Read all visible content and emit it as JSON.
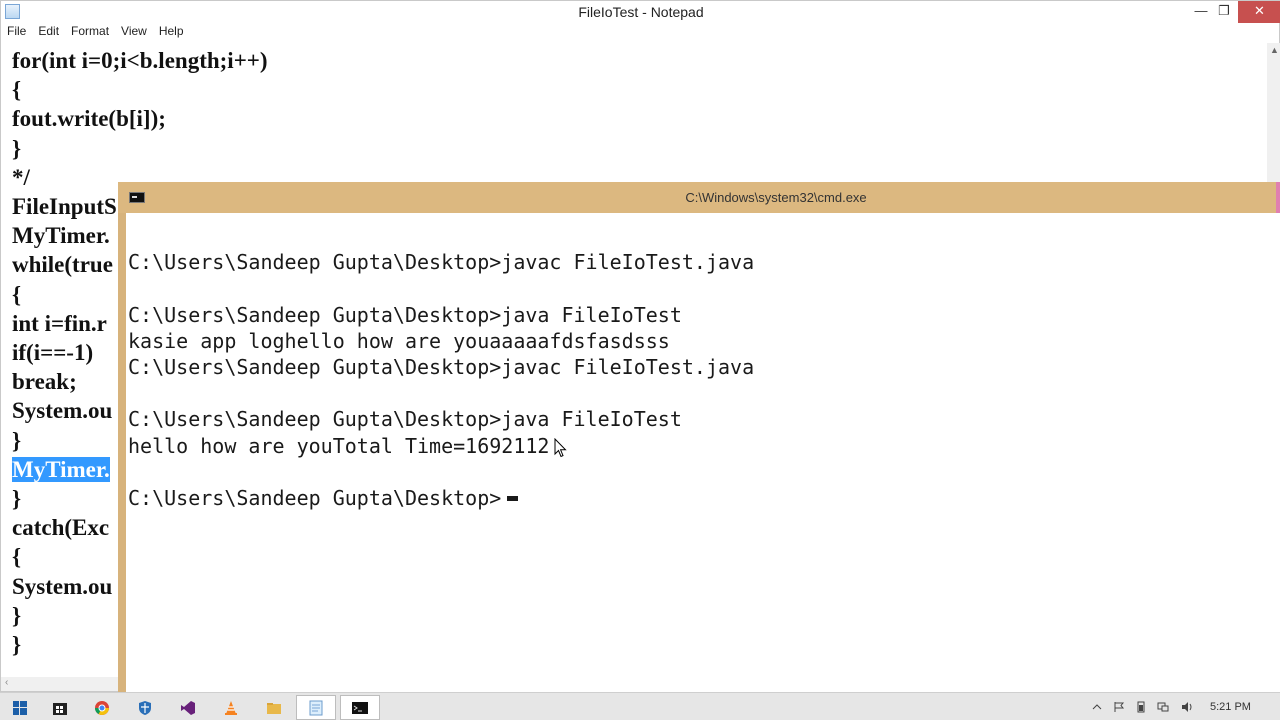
{
  "notepad": {
    "title": "FileIoTest - Notepad",
    "window_buttons": {
      "minimize": "—",
      "maximize": "❐",
      "close": "✕"
    },
    "menu": [
      "File",
      "Edit",
      "Format",
      "View",
      "Help"
    ],
    "code_lines": [
      "for(int i=0;i<b.length;i++)",
      "{",
      "fout.write(b[i]);",
      "}",
      "*/",
      "FileInputS",
      "MyTimer.",
      "while(true",
      "{",
      "int i=fin.r",
      "if(i==-1)",
      "break;",
      "System.ou",
      "}",
      "MyTimer.",
      "}",
      "catch(Exc",
      "{",
      "System.ou",
      "}",
      "}"
    ],
    "selected_line_index": 14
  },
  "cmd": {
    "title": "C:\\Windows\\system32\\cmd.exe",
    "lines": [
      "",
      "C:\\Users\\Sandeep Gupta\\Desktop>javac FileIoTest.java",
      "",
      "C:\\Users\\Sandeep Gupta\\Desktop>java FileIoTest",
      "kasie app loghello how are youaaaaafdsfasdsss",
      "C:\\Users\\Sandeep Gupta\\Desktop>javac FileIoTest.java",
      "",
      "C:\\Users\\Sandeep Gupta\\Desktop>java FileIoTest",
      "hello how are youTotal Time=1692112",
      "",
      "C:\\Users\\Sandeep Gupta\\Desktop>"
    ]
  },
  "taskbar": {
    "apps": [
      "start",
      "file-explorer-store",
      "chrome",
      "defender",
      "visual-studio",
      "vlc",
      "file-explorer",
      "notepad",
      "cmd"
    ],
    "active_app": "cmd",
    "clock": "5:21 PM"
  },
  "colors": {
    "cmd_titlebar": "#dcb880",
    "selection": "#3399ff",
    "close_button": "#c7504f"
  }
}
